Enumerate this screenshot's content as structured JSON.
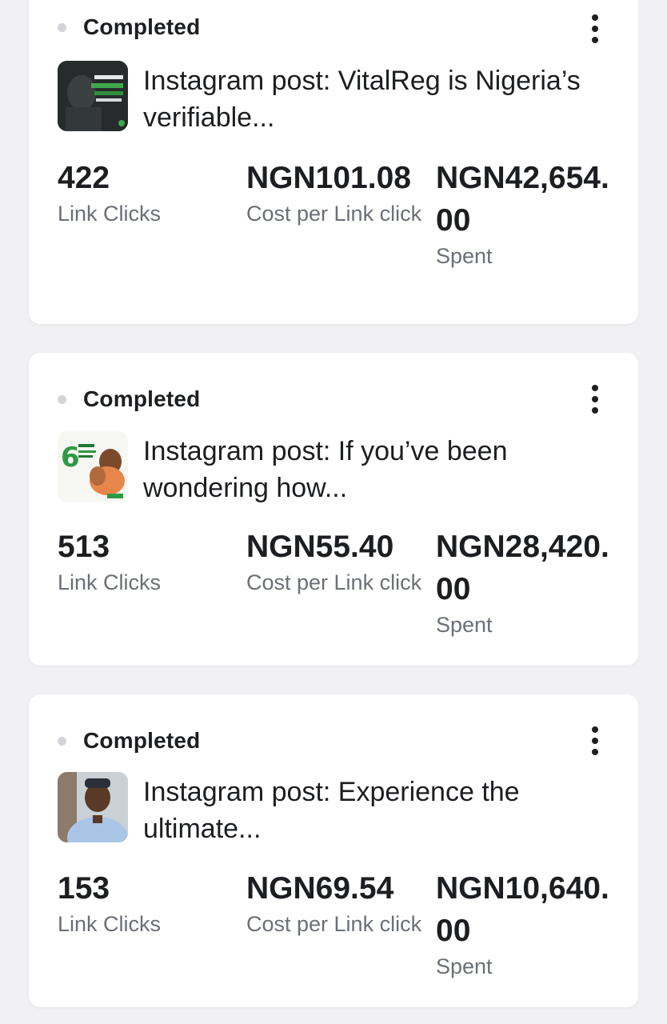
{
  "campaigns": [
    {
      "status": "Completed",
      "title": "Instagram post: VitalReg is Nigeria’s verifiable...",
      "link_clicks": "422",
      "link_clicks_label": "Link Clicks",
      "cost_per_click": "NGN101.08",
      "cost_per_click_label": "Cost per Link click",
      "spent": "NGN42,654.00",
      "spent_label": "Spent",
      "thumbnail": "instagram-post-thumbnail"
    },
    {
      "status": "Completed",
      "title": "Instagram post: If you’ve been wondering how...",
      "link_clicks": "513",
      "link_clicks_label": "Link Clicks",
      "cost_per_click": "NGN55.40",
      "cost_per_click_label": "Cost per Link click",
      "spent": "NGN28,420.00",
      "spent_label": "Spent",
      "thumbnail": "instagram-post-thumbnail"
    },
    {
      "status": "Completed",
      "title": "Instagram post: Experience the ultimate...",
      "link_clicks": "153",
      "link_clicks_label": "Link Clicks",
      "cost_per_click": "NGN69.54",
      "cost_per_click_label": "Cost per Link click",
      "spent": "NGN10,640.00",
      "spent_label": "Spent",
      "thumbnail": "instagram-post-thumbnail"
    }
  ],
  "colors": {
    "background": "#f1f1f3",
    "card": "#ffffff",
    "text_primary": "#1c1e21",
    "text_secondary": "#6b6f76",
    "status_dot": "#d2d4d8"
  }
}
